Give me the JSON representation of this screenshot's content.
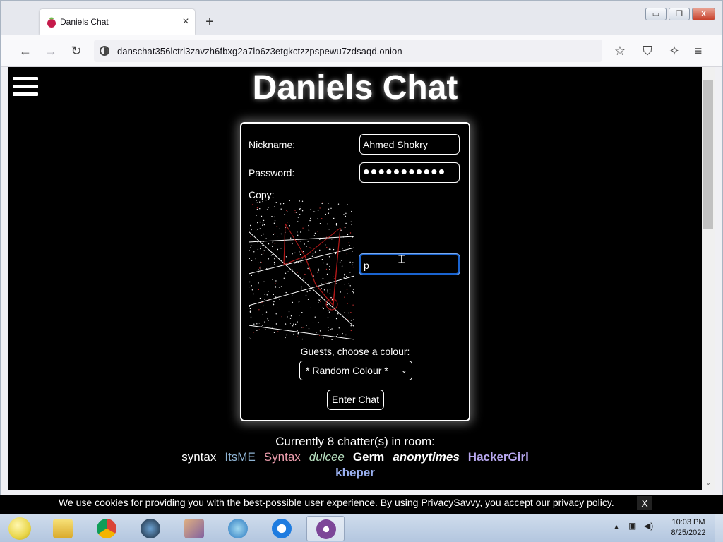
{
  "browser": {
    "tab_title": "Daniels Chat",
    "tab_close": "×",
    "new_tab": "+",
    "url": "danschat356lctri3zavzh6fbxg2a7lo6z3etgkctzzpspewu7zdsaqd.onion",
    "window_controls": {
      "minimize": "▭",
      "maximize": "❐",
      "close": "X"
    }
  },
  "page": {
    "title": "Daniels Chat",
    "form": {
      "nickname_label": "Nickname:",
      "nickname_value": "Ahmed Shokry",
      "password_label": "Password:",
      "password_value": "●●●●●●●●●●●",
      "copy_label": "Copy:",
      "captcha_value": "p",
      "colour_label": "Guests, choose a colour:",
      "colour_selected": "* Random Colour *",
      "enter_button": "Enter Chat"
    },
    "captcha_chars": [
      "q",
      "Q",
      "Z",
      "p",
      "n",
      "z",
      "e",
      "z",
      "K",
      "D"
    ],
    "chatters_title": "Currently 8 chatter(s) in room:",
    "chatters": [
      {
        "name": "syntax",
        "color": "#ffffff",
        "bold": false,
        "italic": false
      },
      {
        "name": "ItsME",
        "color": "#8fb4d4",
        "bold": false,
        "italic": false
      },
      {
        "name": "Syntax",
        "color": "#f0a0b0",
        "bold": false,
        "italic": false
      },
      {
        "name": "dulcee",
        "color": "#b8e0c0",
        "bold": false,
        "italic": true
      },
      {
        "name": "Germ",
        "color": "#ffffff",
        "bold": true,
        "italic": false
      },
      {
        "name": "anonytimes",
        "color": "#ffffff",
        "bold": true,
        "italic": true
      },
      {
        "name": "HackerGirl",
        "color": "#b8a8f0",
        "bold": true,
        "italic": false
      },
      {
        "name": "kheper",
        "color": "#9ab0f0",
        "bold": true,
        "italic": false
      }
    ]
  },
  "cookie_banner": {
    "message": "We use cookies for providing you with the best-possible user experience. By using PrivacySavvy, you accept ",
    "policy_link": "our privacy policy",
    "suffix": ".",
    "close": "X"
  },
  "taskbar": {
    "apps": [
      "explorer",
      "chrome",
      "steam",
      "image-viewer",
      "ie-calendar",
      "avast-secure",
      "tor-browser"
    ],
    "clock_time": "10:03 PM",
    "clock_date": "8/25/2022"
  }
}
